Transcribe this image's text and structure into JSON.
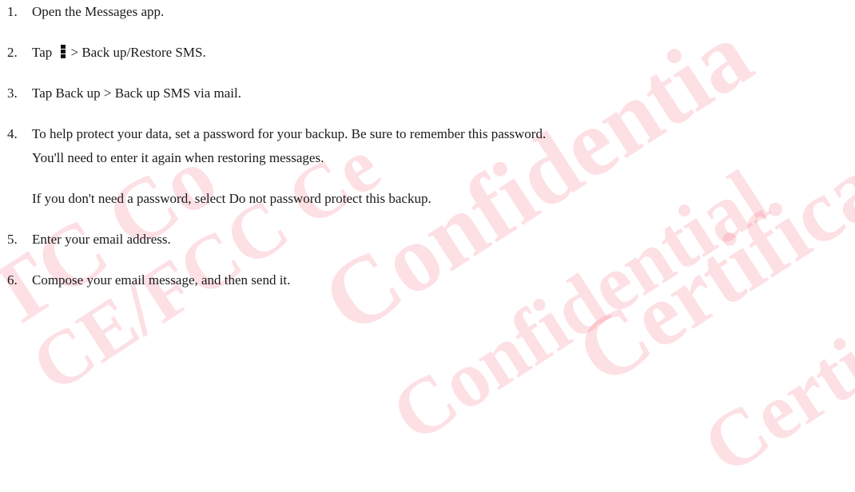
{
  "watermark": {
    "lines": [
      "TC Co",
      "CE/FCC Ce",
      "Confidentia",
      "Confidential",
      "Certificatio",
      "Certif"
    ]
  },
  "steps": [
    {
      "number": "1.",
      "text": "Open the Messages app."
    },
    {
      "number": "2.",
      "text_before": "Tap",
      "icon": "more-options-icon",
      "text_after": "> Back up/Restore SMS."
    },
    {
      "number": "3.",
      "text": "Tap Back up > Back up SMS via mail."
    },
    {
      "number": "4.",
      "text": "To help protect your data, set a password for your backup. Be sure to remember this password.",
      "text_continued": "You'll need to enter it again when restoring messages.",
      "note": "If you don't need a password, select Do not password protect this backup."
    },
    {
      "number": "5.",
      "text": "Enter your email address."
    },
    {
      "number": "6.",
      "text": "Compose your email message, and then send it."
    }
  ]
}
